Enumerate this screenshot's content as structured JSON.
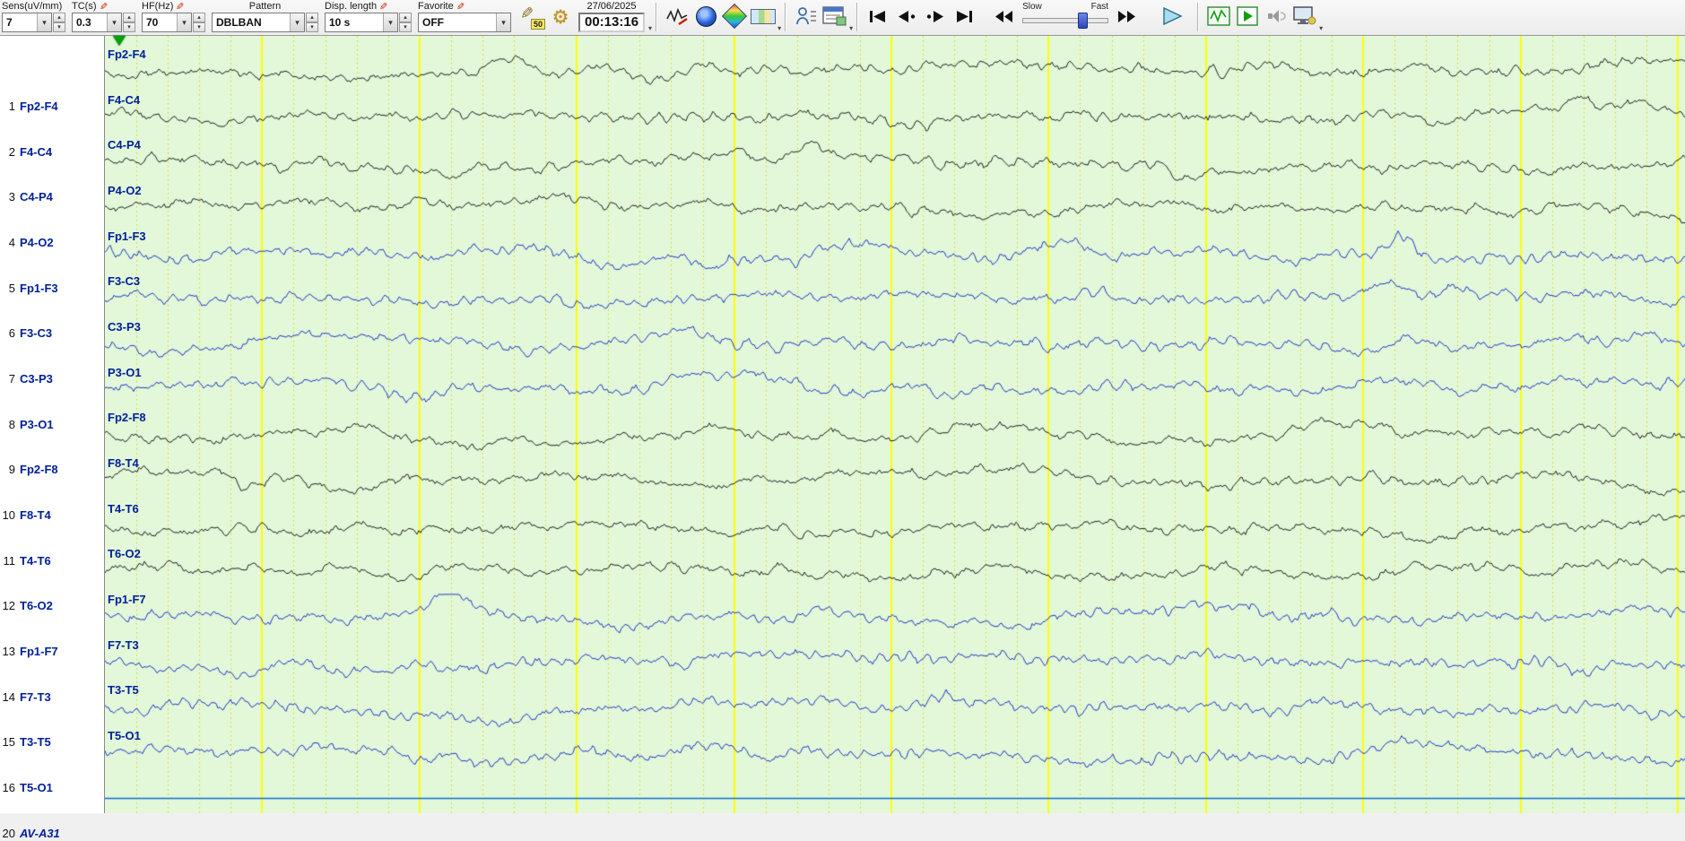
{
  "toolbar": {
    "sens": {
      "label": "Sens(uV/mm)",
      "value": "7"
    },
    "tc": {
      "label": "TC(s)",
      "value": "0.3"
    },
    "hf": {
      "label": "HF(Hz)",
      "value": "70"
    },
    "pattern": {
      "label": "Pattern",
      "value": "DBLBAN"
    },
    "disp": {
      "label": "Disp. length",
      "value": "10 s"
    },
    "favorite": {
      "label": "Favorite",
      "value": "OFF"
    },
    "notch_badge": "50",
    "date": "27/06/2025",
    "time": "00:13:16",
    "slider": {
      "slow": "Slow",
      "fast": "Fast"
    }
  },
  "icons": {
    "pen": "✎",
    "gear": "⚙",
    "arrow_up": "▴",
    "arrow_down": "▾"
  },
  "display": {
    "background": "#e2f8d9",
    "grid_major_color": "#ffff00",
    "grid_minor_color": "#e3d400",
    "seconds_per_page": 10,
    "label_color": "#00209a",
    "black_trace_color": "#202020",
    "blue_trace_color": "#2436c4",
    "flat_trace_color": "#0a6fd2"
  },
  "channels": [
    {
      "num": "1",
      "label": "Fp2-F4",
      "color": "#202020"
    },
    {
      "num": "2",
      "label": "F4-C4",
      "color": "#202020"
    },
    {
      "num": "3",
      "label": "C4-P4",
      "color": "#202020"
    },
    {
      "num": "4",
      "label": "P4-O2",
      "color": "#202020"
    },
    {
      "num": "5",
      "label": "Fp1-F3",
      "color": "#2436c4"
    },
    {
      "num": "6",
      "label": "F3-C3",
      "color": "#2436c4"
    },
    {
      "num": "7",
      "label": "C3-P3",
      "color": "#2436c4"
    },
    {
      "num": "8",
      "label": "P3-O1",
      "color": "#2436c4"
    },
    {
      "num": "9",
      "label": "Fp2-F8",
      "color": "#202020"
    },
    {
      "num": "10",
      "label": "F8-T4",
      "color": "#202020"
    },
    {
      "num": "11",
      "label": "T4-T6",
      "color": "#202020"
    },
    {
      "num": "12",
      "label": "T6-O2",
      "color": "#202020"
    },
    {
      "num": "13",
      "label": "Fp1-F7",
      "color": "#2436c4"
    },
    {
      "num": "14",
      "label": "F7-T3",
      "color": "#2436c4"
    },
    {
      "num": "15",
      "label": "T3-T5",
      "color": "#2436c4"
    },
    {
      "num": "16",
      "label": "T5-O1",
      "color": "#2436c4"
    },
    {
      "num": "20",
      "label": "AV-A31",
      "color": "#0a6fd2",
      "flat": true,
      "italic": true
    }
  ]
}
